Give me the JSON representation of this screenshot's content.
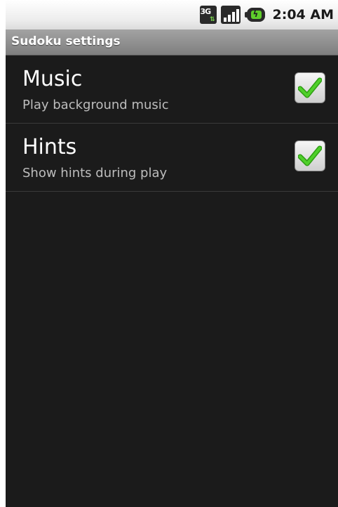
{
  "status_bar": {
    "network_type": "3G",
    "time": "2:04 AM",
    "icons": [
      "network-3g-icon",
      "signal-strength-icon",
      "battery-charging-icon"
    ]
  },
  "title_bar": {
    "title": "Sudoku settings"
  },
  "preferences": [
    {
      "title": "Music",
      "summary": "Play background music",
      "checked": true
    },
    {
      "title": "Hints",
      "summary": "Show hints during play",
      "checked": true
    }
  ],
  "colors": {
    "background": "#1b1b1b",
    "title_bar": "#8e8e8e",
    "check": "#3cc21b",
    "summary_text": "#bdbdbd"
  }
}
